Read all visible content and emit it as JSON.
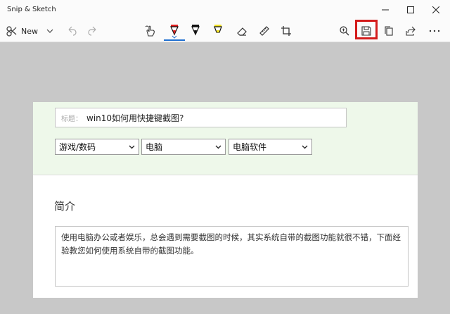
{
  "window": {
    "title": "Snip & Sketch"
  },
  "toolbar": {
    "new_label": "New",
    "tools": [
      {
        "name": "undo"
      },
      {
        "name": "redo"
      },
      {
        "name": "touch-writing"
      },
      {
        "name": "ballpoint-pen",
        "color": "#e02020"
      },
      {
        "name": "pencil",
        "color": "#111111"
      },
      {
        "name": "highlighter",
        "color": "#f0e020"
      },
      {
        "name": "eraser"
      },
      {
        "name": "ruler"
      },
      {
        "name": "crop"
      },
      {
        "name": "zoom"
      },
      {
        "name": "save"
      },
      {
        "name": "copy"
      },
      {
        "name": "share"
      },
      {
        "name": "more"
      }
    ],
    "highlight_color": "#d41c1c",
    "accent": "#1f6fd0"
  },
  "form": {
    "title_prefix": "标题：",
    "title_value": "win10如何用快捷键截图?",
    "category1": "游戏/数码",
    "category2": "电脑",
    "category3": "电脑软件",
    "intro_heading": "简介",
    "intro_text": "使用电脑办公或者娱乐，总会遇到需要截图的时候，其实系统自带的截图功能就很不错，下面经验教您如何使用系统自带的截图功能。"
  }
}
